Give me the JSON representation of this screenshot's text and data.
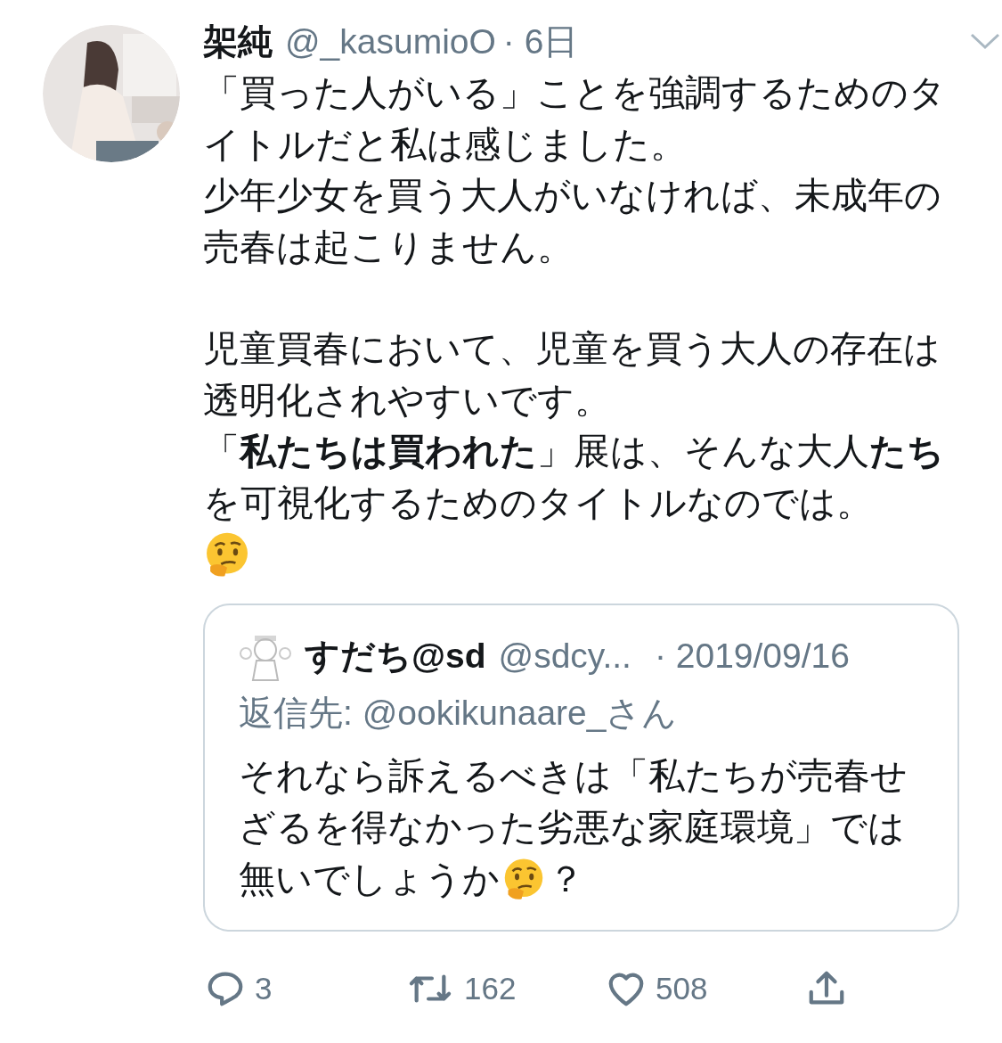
{
  "tweet": {
    "name": "架純",
    "handle": "@_kasumioO",
    "time": "· 6日",
    "paragraphs": [
      [
        "「買った人がいる」ことを強調するためのタイトルだと私は感じました。",
        "少年少女を買う大人がいなければ、未成年の売春は起こりません。"
      ],
      [
        "児童買春において、児童を買う大人の存在は透明化されやすいです。",
        "「**私たちは買われた**」展は、そんな大人**たち**を可視化するためのタイトルなのでは。"
      ]
    ],
    "quote": {
      "name": "すだち@sd",
      "handle": "@sdcy...",
      "time": "· 2019/09/16",
      "reply_to": "返信先: @ookikunaare_さん",
      "text": "それなら訴えるべきは「私たちが売春せざるを得なかった劣悪な家庭環境」では",
      "text_last_line": "無いでしょうか",
      "text_end": "？"
    },
    "actions": [
      {
        "kind": "reply",
        "count": "3"
      },
      {
        "kind": "retweet",
        "count": "162"
      },
      {
        "kind": "like",
        "count": "508"
      },
      {
        "kind": "share"
      }
    ]
  }
}
